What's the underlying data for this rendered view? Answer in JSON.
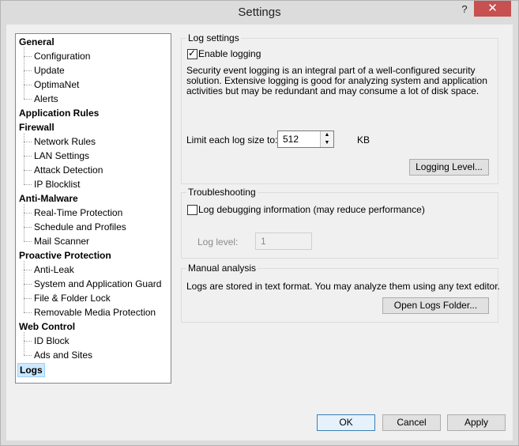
{
  "window": {
    "title": "Settings",
    "help": "?",
    "close": "✕"
  },
  "tree": {
    "items": [
      {
        "label": "General",
        "kind": "cat"
      },
      {
        "label": "Configuration",
        "kind": "sub"
      },
      {
        "label": "Update",
        "kind": "sub"
      },
      {
        "label": "OptimaNet",
        "kind": "sub"
      },
      {
        "label": "Alerts",
        "kind": "sub"
      },
      {
        "label": "Application Rules",
        "kind": "cat"
      },
      {
        "label": "Firewall",
        "kind": "cat"
      },
      {
        "label": "Network Rules",
        "kind": "sub"
      },
      {
        "label": "LAN Settings",
        "kind": "sub"
      },
      {
        "label": "Attack Detection",
        "kind": "sub"
      },
      {
        "label": "IP Blocklist",
        "kind": "sub"
      },
      {
        "label": "Anti-Malware",
        "kind": "cat"
      },
      {
        "label": "Real-Time Protection",
        "kind": "sub"
      },
      {
        "label": "Schedule and Profiles",
        "kind": "sub"
      },
      {
        "label": "Mail Scanner",
        "kind": "sub"
      },
      {
        "label": "Proactive Protection",
        "kind": "cat"
      },
      {
        "label": "Anti-Leak",
        "kind": "sub"
      },
      {
        "label": "System and Application Guard",
        "kind": "sub"
      },
      {
        "label": "File & Folder Lock",
        "kind": "sub"
      },
      {
        "label": "Removable Media Protection",
        "kind": "sub"
      },
      {
        "label": "Web Control",
        "kind": "cat"
      },
      {
        "label": "ID Block",
        "kind": "sub"
      },
      {
        "label": "Ads and Sites",
        "kind": "sub"
      },
      {
        "label": "Logs",
        "kind": "cat",
        "selected": true
      }
    ]
  },
  "log_settings": {
    "group_label": "Log settings",
    "enable_logging_label": "Enable logging",
    "enable_logging_checked": true,
    "description": "Security event logging is an integral part of a well-configured security solution. Extensive logging is good for analyzing system and application activities but may be redundant and may consume a lot of disk space.",
    "limit_label": "Limit each log size to:",
    "limit_value": "512",
    "limit_unit": "KB",
    "logging_level_button": "Logging Level..."
  },
  "troubleshooting": {
    "group_label": "Troubleshooting",
    "debug_label": "Log debugging information (may reduce performance)",
    "debug_checked": false,
    "log_level_label": "Log level:",
    "log_level_value": "1"
  },
  "manual_analysis": {
    "group_label": "Manual analysis",
    "text": "Logs are stored in text format. You may analyze them using any text editor.",
    "open_folder_button": "Open Logs Folder..."
  },
  "footer": {
    "ok": "OK",
    "cancel": "Cancel",
    "apply": "Apply"
  }
}
